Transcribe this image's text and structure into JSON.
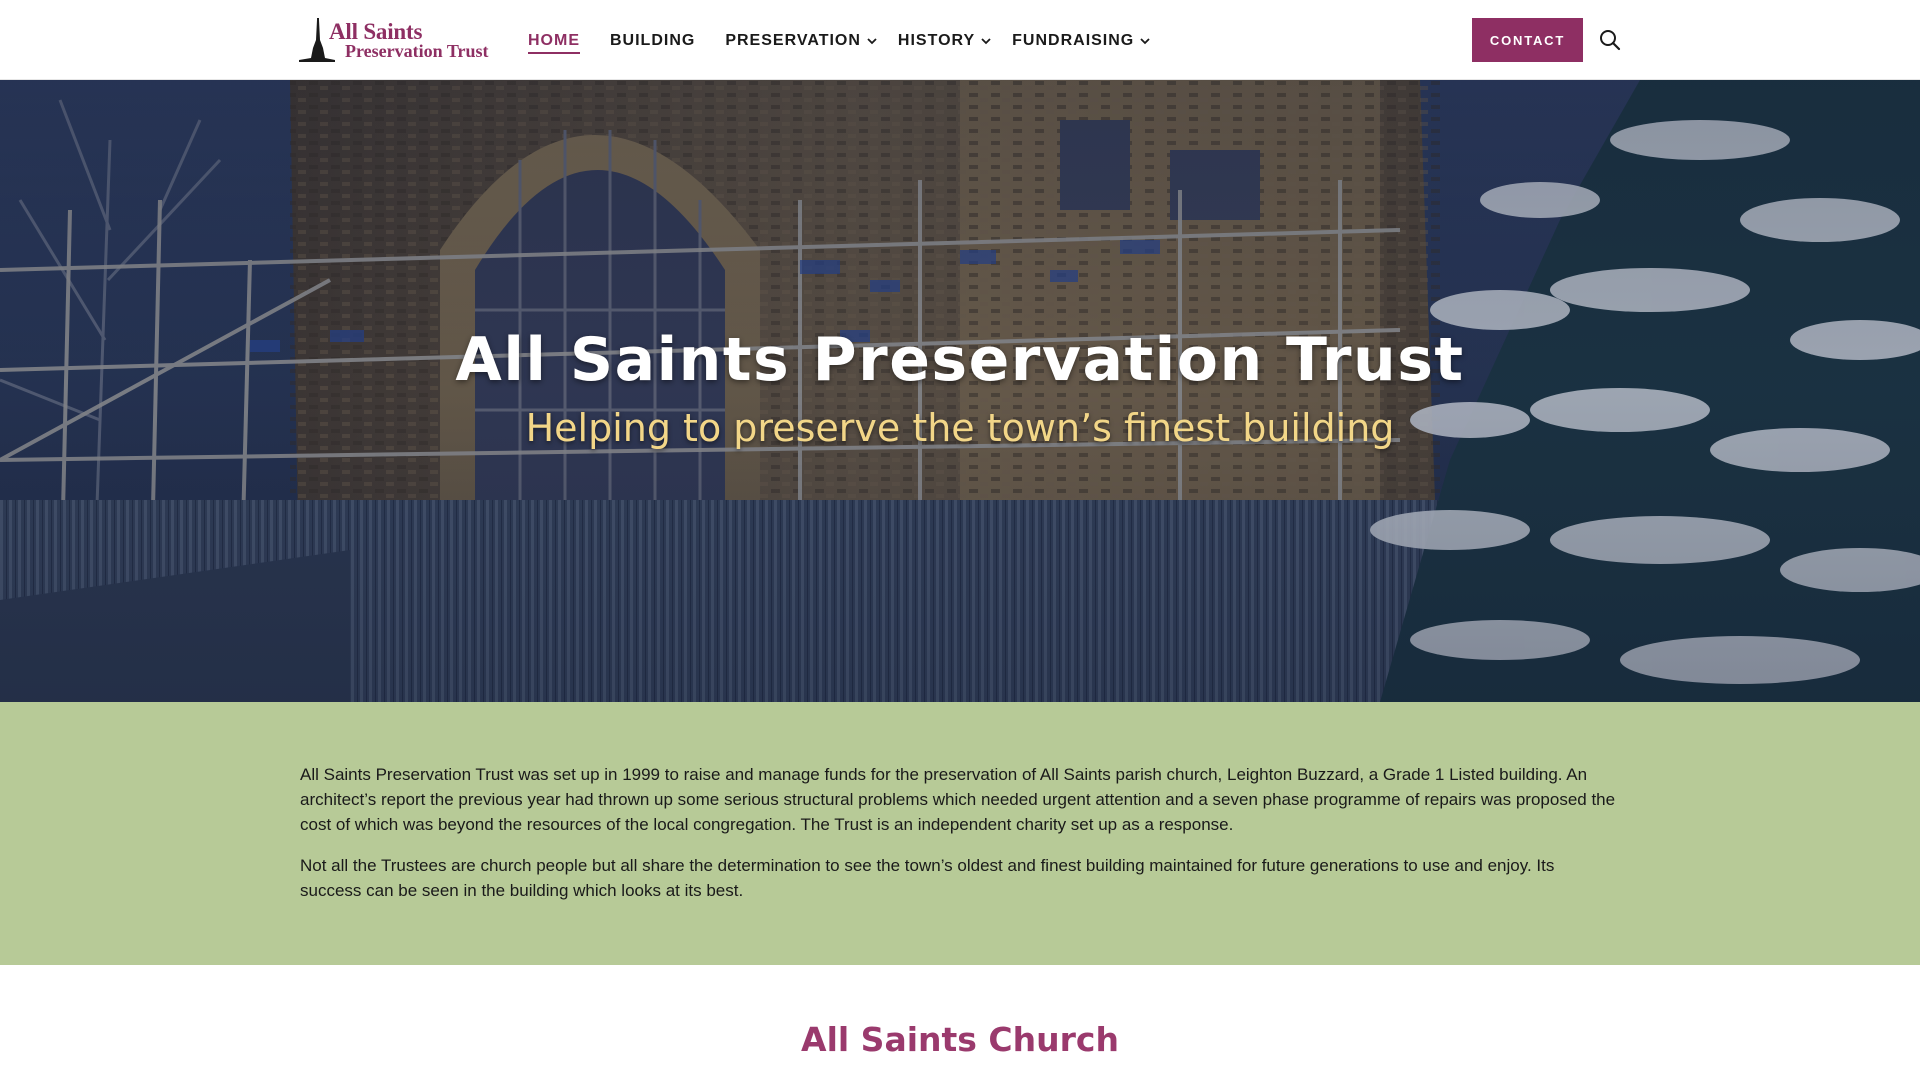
{
  "header": {
    "logo": {
      "line1": "All Saints",
      "line2": "Preservation Trust"
    },
    "nav": [
      {
        "label": "HOME",
        "active": true,
        "has_dropdown": false
      },
      {
        "label": "BUILDING",
        "active": false,
        "has_dropdown": false
      },
      {
        "label": "PRESERVATION",
        "active": false,
        "has_dropdown": true
      },
      {
        "label": "HISTORY",
        "active": false,
        "has_dropdown": true
      },
      {
        "label": "FUNDRAISING",
        "active": false,
        "has_dropdown": true
      }
    ],
    "contact_label": "CONTACT",
    "search_icon": "search-icon"
  },
  "hero": {
    "title": "All Saints Preservation Trust",
    "subtitle": "Helping to preserve the town’s finest building"
  },
  "intro": {
    "paragraphs": [
      "All Saints Preservation Trust was set up in 1999 to raise and manage funds for the preservation of All Saints parish church, Leighton Buzzard, a Grade 1 Listed building. An architect’s report the previous year had thrown up some serious structural problems which needed urgent attention and a seven phase programme of repairs was proposed the cost of which was beyond the resources of the local congregation. The Trust is an independent charity set up as a response.",
      "Not all the Trustees are church people but all share the determination to see the town’s oldest and finest building maintained for future generations to use and enjoy. Its success can be seen in the building which looks at its best."
    ]
  },
  "church_section": {
    "heading": "All Saints Church"
  },
  "colors": {
    "brand": "#8e2f63",
    "intro_background": "#b7ca97",
    "hero_subtitle": "#f2d688",
    "text": "#1a1a1a"
  }
}
